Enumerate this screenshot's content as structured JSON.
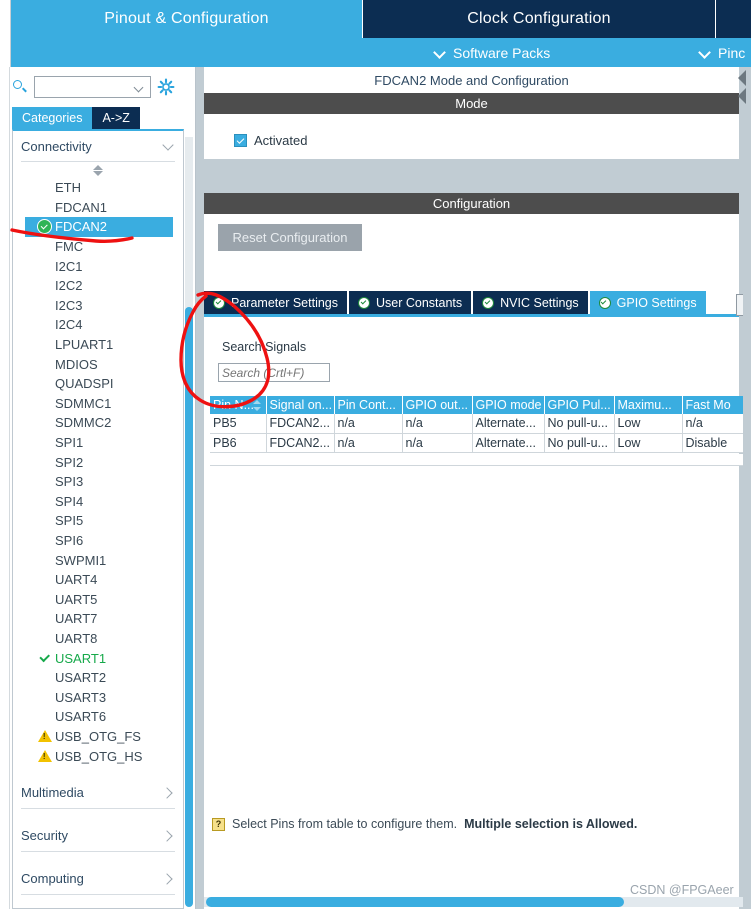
{
  "window": {
    "main_tabs": [
      {
        "label": "Pinout & Configuration",
        "active": true
      },
      {
        "label": "Clock Configuration",
        "active": false
      },
      {
        "label": "",
        "active": false
      }
    ],
    "sub_bar": {
      "software_packs": "Software Packs",
      "pinout_menu": "Pinc"
    }
  },
  "sidebar": {
    "search": {
      "value": "",
      "placeholder": ""
    },
    "gear_icon": "gear-icon",
    "view_tabs": [
      {
        "label": "Categories",
        "active": true
      },
      {
        "label": "A->Z",
        "active": false
      }
    ],
    "groups": [
      {
        "label": "Connectivity",
        "expanded": true,
        "chevron": "chevron-down-icon"
      },
      {
        "label": "Multimedia",
        "expanded": false,
        "chevron": "chevron-right-icon"
      },
      {
        "label": "Security",
        "expanded": false,
        "chevron": "chevron-right-icon"
      },
      {
        "label": "Computing",
        "expanded": false,
        "chevron": "chevron-right-icon"
      }
    ],
    "peripherals": [
      {
        "label": "ETH",
        "state": "none",
        "selected": false
      },
      {
        "label": "FDCAN1",
        "state": "none",
        "selected": false
      },
      {
        "label": "FDCAN2",
        "state": "configured",
        "selected": true
      },
      {
        "label": "FMC",
        "state": "none",
        "selected": false
      },
      {
        "label": "I2C1",
        "state": "none",
        "selected": false
      },
      {
        "label": "I2C2",
        "state": "none",
        "selected": false
      },
      {
        "label": "I2C3",
        "state": "none",
        "selected": false
      },
      {
        "label": "I2C4",
        "state": "none",
        "selected": false
      },
      {
        "label": "LPUART1",
        "state": "none",
        "selected": false
      },
      {
        "label": "MDIOS",
        "state": "none",
        "selected": false
      },
      {
        "label": "QUADSPI",
        "state": "none",
        "selected": false
      },
      {
        "label": "SDMMC1",
        "state": "none",
        "selected": false
      },
      {
        "label": "SDMMC2",
        "state": "none",
        "selected": false
      },
      {
        "label": "SPI1",
        "state": "none",
        "selected": false
      },
      {
        "label": "SPI2",
        "state": "none",
        "selected": false
      },
      {
        "label": "SPI3",
        "state": "none",
        "selected": false
      },
      {
        "label": "SPI4",
        "state": "none",
        "selected": false
      },
      {
        "label": "SPI5",
        "state": "none",
        "selected": false
      },
      {
        "label": "SPI6",
        "state": "none",
        "selected": false
      },
      {
        "label": "SWPMI1",
        "state": "none",
        "selected": false
      },
      {
        "label": "UART4",
        "state": "none",
        "selected": false
      },
      {
        "label": "UART5",
        "state": "none",
        "selected": false
      },
      {
        "label": "UART7",
        "state": "none",
        "selected": false
      },
      {
        "label": "UART8",
        "state": "none",
        "selected": false
      },
      {
        "label": "USART1",
        "state": "ok",
        "selected": false
      },
      {
        "label": "USART2",
        "state": "none",
        "selected": false
      },
      {
        "label": "USART3",
        "state": "none",
        "selected": false
      },
      {
        "label": "USART6",
        "state": "none",
        "selected": false
      },
      {
        "label": "USB_OTG_FS",
        "state": "warning",
        "selected": false
      },
      {
        "label": "USB_OTG_HS",
        "state": "warning",
        "selected": false
      }
    ]
  },
  "main": {
    "panel_title": "FDCAN2 Mode and Configuration",
    "mode": {
      "band_label": "Mode",
      "activated_label": "Activated",
      "activated_checked": true
    },
    "configuration": {
      "band_label": "Configuration",
      "reset_button": "Reset Configuration",
      "tabs": [
        {
          "label": "Parameter Settings",
          "active": false
        },
        {
          "label": "User Constants",
          "active": false
        },
        {
          "label": "NVIC Settings",
          "active": false
        },
        {
          "label": "GPIO Settings",
          "active": true
        }
      ]
    },
    "signals": {
      "section_label": "Search Signals",
      "search_value": "",
      "search_placeholder": "Search (Crtl+F)"
    },
    "table": {
      "columns": [
        "Pin N...",
        "Signal on...",
        "Pin Cont...",
        "GPIO out...",
        "GPIO mode",
        "GPIO Pul...",
        "Maximu...",
        "Fast Mo"
      ],
      "sort_column": "Pin N...",
      "rows": [
        {
          "pin_name": "PB5",
          "signal_on_pin": "FDCAN2...",
          "pin_context": "n/a",
          "gpio_output": "n/a",
          "gpio_mode": "Alternate...",
          "gpio_pull": "No pull-u...",
          "maximum_speed": "Low",
          "fast_mode": "n/a"
        },
        {
          "pin_name": "PB6",
          "signal_on_pin": "FDCAN2...",
          "pin_context": "n/a",
          "gpio_output": "n/a",
          "gpio_mode": "Alternate...",
          "gpio_pull": "No pull-u...",
          "maximum_speed": "Low",
          "fast_mode": "Disable"
        }
      ]
    },
    "hint": {
      "icon": "help-tooltip-icon",
      "text": "Select Pins from table to configure them.",
      "emphasis": "Multiple selection is Allowed."
    }
  },
  "watermark": "CSDN @FPGAeer",
  "colors": {
    "accent_blue": "#3aade0",
    "dark_navy": "#0c2d52",
    "band_gray": "#4d4d4d",
    "panel_gray": "#c1ccd3",
    "green_ok": "#16a94a",
    "warn_yellow": "#f2c200",
    "annotation_red": "#ee1111"
  }
}
